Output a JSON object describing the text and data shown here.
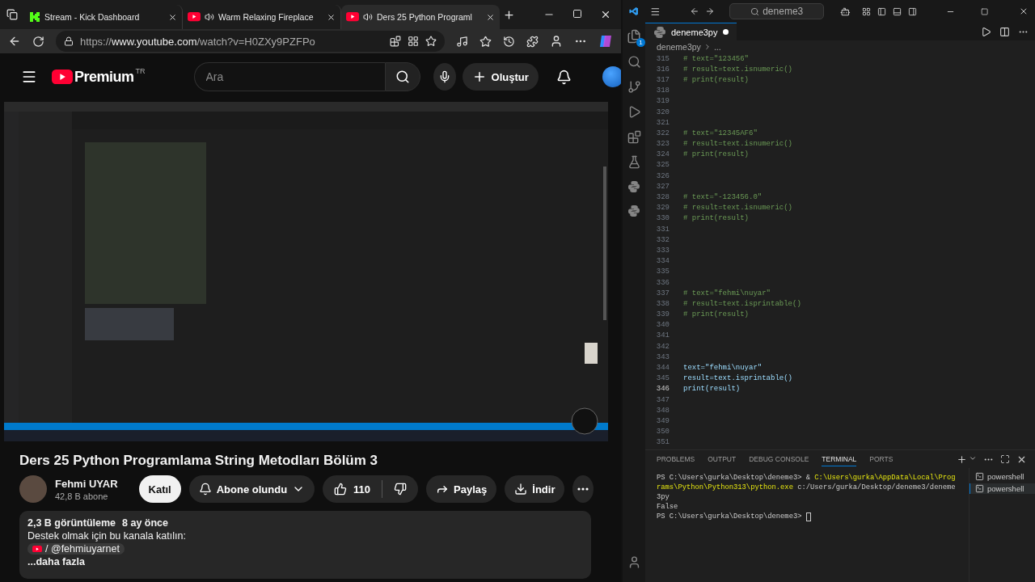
{
  "browser": {
    "tabs": [
      {
        "title": "Stream - Kick Dashboard",
        "kind": "kick",
        "audio": false,
        "selected": false
      },
      {
        "title": "Warm Relaxing Fireplace",
        "kind": "youtube",
        "audio": true,
        "selected": false
      },
      {
        "title": "Ders 25 Python Programl",
        "kind": "youtube",
        "audio": true,
        "selected": true
      }
    ],
    "url": {
      "prefix": "https://",
      "host": "www.youtube.com",
      "path": "/watch?v=H0ZXy9PZFPo"
    }
  },
  "youtube": {
    "logo": "Premium",
    "region": "TR",
    "search": {
      "placeholder": "Ara"
    },
    "create_button": "Oluştur",
    "title": "Ders 25 Python Programlama String Metodları Bölüm 3",
    "channel": {
      "name": "Fehmi UYAR",
      "subscribers": "42,8 B abone"
    },
    "join_button": "Katıl",
    "subscribe_button": "Abone olundu",
    "likes": "110",
    "share_button": "Paylaş",
    "download_button": "İndir",
    "description": {
      "views": "2,3 B görüntüleme",
      "age": "8 ay önce",
      "text": "Destek olmak için bu kanala katılın:",
      "link": "/ @fehmiuyarnet",
      "more": "...daha fazla"
    }
  },
  "vscode": {
    "search": "deneme3",
    "explorer_badge": "1",
    "tab": {
      "title": "deneme3py",
      "modified": true
    },
    "breadcrumb": {
      "file": "deneme3py",
      "rest": "..."
    },
    "lines": [
      {
        "number": "315",
        "kind": "comment",
        "text": "# text=\"123456\"",
        "current": false
      },
      {
        "number": "316",
        "kind": "comment",
        "text": "# result=text.isnumeric()",
        "current": false
      },
      {
        "number": "317",
        "kind": "comment",
        "text": "# print(result)",
        "current": false
      },
      {
        "number": "318",
        "current": false
      },
      {
        "number": "319",
        "current": false
      },
      {
        "number": "320",
        "current": false
      },
      {
        "number": "321",
        "current": false
      },
      {
        "number": "322",
        "kind": "comment",
        "text": "# text=\"12345AF6\"",
        "current": false
      },
      {
        "number": "323",
        "kind": "comment",
        "text": "# result=text.isnumeric()",
        "current": false
      },
      {
        "number": "324",
        "kind": "comment",
        "text": "# print(result)",
        "current": false
      },
      {
        "number": "325",
        "current": false
      },
      {
        "number": "326",
        "current": false
      },
      {
        "number": "327",
        "current": false
      },
      {
        "number": "328",
        "kind": "comment",
        "text": "# text=\"-123456.0\"",
        "current": false
      },
      {
        "number": "329",
        "kind": "comment",
        "text": "# result=text.isnumeric()",
        "current": false
      },
      {
        "number": "330",
        "kind": "comment",
        "text": "# print(result)",
        "current": false
      },
      {
        "number": "331",
        "current": false
      },
      {
        "number": "332",
        "current": false
      },
      {
        "number": "333",
        "current": false
      },
      {
        "number": "334",
        "current": false
      },
      {
        "number": "335",
        "current": false
      },
      {
        "number": "336",
        "current": false
      },
      {
        "number": "337",
        "kind": "comment",
        "text": "# text=\"fehmi\\nuyar\"",
        "current": false
      },
      {
        "number": "338",
        "kind": "comment",
        "text": "# result=text.isprintable()",
        "current": false
      },
      {
        "number": "339",
        "kind": "comment",
        "text": "# print(result)",
        "current": false
      },
      {
        "number": "340",
        "current": false
      },
      {
        "number": "341",
        "current": false
      },
      {
        "number": "342",
        "current": false
      },
      {
        "number": "343",
        "current": false
      },
      {
        "number": "344",
        "kind": "code",
        "text": "text=\"fehmi\\nuyar\"",
        "current": false
      },
      {
        "number": "345",
        "kind": "code",
        "text": "result=text.isprintable()",
        "current": false
      },
      {
        "number": "346",
        "kind": "code",
        "text": "print(result)",
        "current": true
      },
      {
        "number": "347",
        "current": false
      },
      {
        "number": "348",
        "current": false
      },
      {
        "number": "349",
        "current": false
      },
      {
        "number": "350",
        "current": false
      },
      {
        "number": "351",
        "current": false
      }
    ],
    "panel_tabs": [
      {
        "label": "PROBLEMS",
        "selected": false
      },
      {
        "label": "OUTPUT",
        "selected": false
      },
      {
        "label": "DEBUG CONSOLE",
        "selected": false
      },
      {
        "label": "TERMINAL",
        "selected": true
      },
      {
        "label": "PORTS",
        "selected": false
      }
    ],
    "terminal": [
      [
        {
          "text": "PS C:\\Users\\gurka\\Desktop\\deneme3> & ",
          "kind": "plain"
        },
        {
          "text": "C:\\Users\\gurka\\AppData\\Local\\Prog",
          "kind": "path"
        }
      ],
      [
        {
          "text": "rams\\Python\\Python313\\python.exe",
          "kind": "path"
        },
        {
          "text": " c:/Users/gurka/Desktop/deneme3/deneme",
          "kind": "plain"
        }
      ],
      [
        {
          "text": "3py",
          "kind": "plain"
        }
      ],
      [
        {
          "text": "False",
          "kind": "plain"
        }
      ],
      [
        {
          "text": "PS C:\\Users\\gurka\\Desktop\\deneme3> ",
          "kind": "prompt"
        }
      ]
    ],
    "terminals": [
      {
        "label": "powershell",
        "selected": false
      },
      {
        "label": "powershell",
        "selected": true
      }
    ]
  }
}
